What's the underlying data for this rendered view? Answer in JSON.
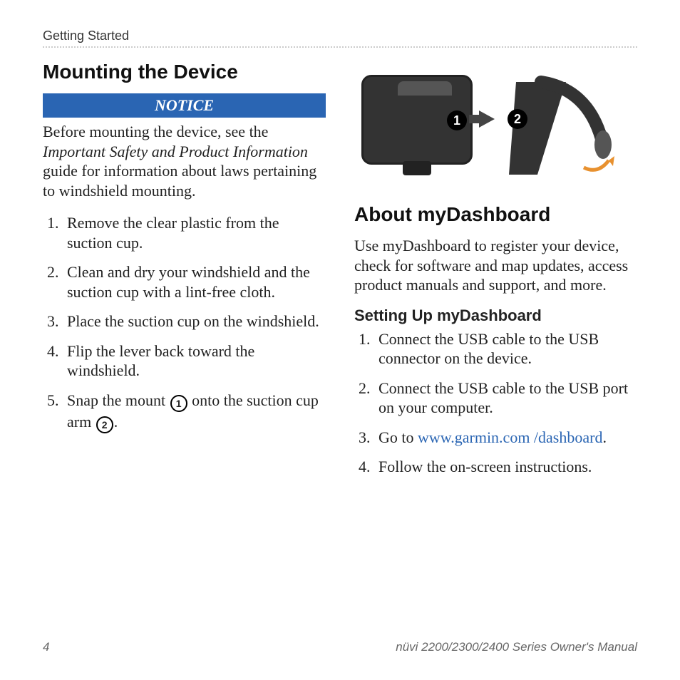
{
  "header": {
    "section": "Getting Started"
  },
  "left": {
    "title": "Mounting the Device",
    "notice_label": "NOTICE",
    "notice_before": "Before mounting the device, see the ",
    "notice_ital": "Important Safety and Product Information",
    "notice_after": " guide for information about laws pertaining to windshield mounting.",
    "steps": {
      "s1": "Remove the clear plastic from the suction cup.",
      "s2": "Clean and dry your windshield and the suction cup with a lint-free cloth.",
      "s3": "Place the suction cup on the windshield.",
      "s4": "Flip the lever back toward the windshield.",
      "s5a": "Snap the mount ",
      "s5b": " onto the suction cup arm ",
      "s5c": "."
    }
  },
  "callouts": {
    "c1": "1",
    "c2": "2"
  },
  "inline_circles": {
    "one": "1",
    "two": "2"
  },
  "right": {
    "title": "About myDashboard",
    "intro": "Use myDashboard to register your device, check for software and map updates, access product manuals and support, and more.",
    "subhead": "Setting Up myDashboard",
    "steps": {
      "s1": "Connect the USB cable to the USB connector on the device.",
      "s2": "Connect the USB cable to the USB port on your computer.",
      "s3a": "Go to ",
      "s3link": "www.garmin.com /dashboard",
      "s3b": ".",
      "s4": "Follow the on-screen instructions."
    }
  },
  "footer": {
    "page": "4",
    "manual": "nüvi 2200/2300/2400 Series Owner's Manual"
  }
}
